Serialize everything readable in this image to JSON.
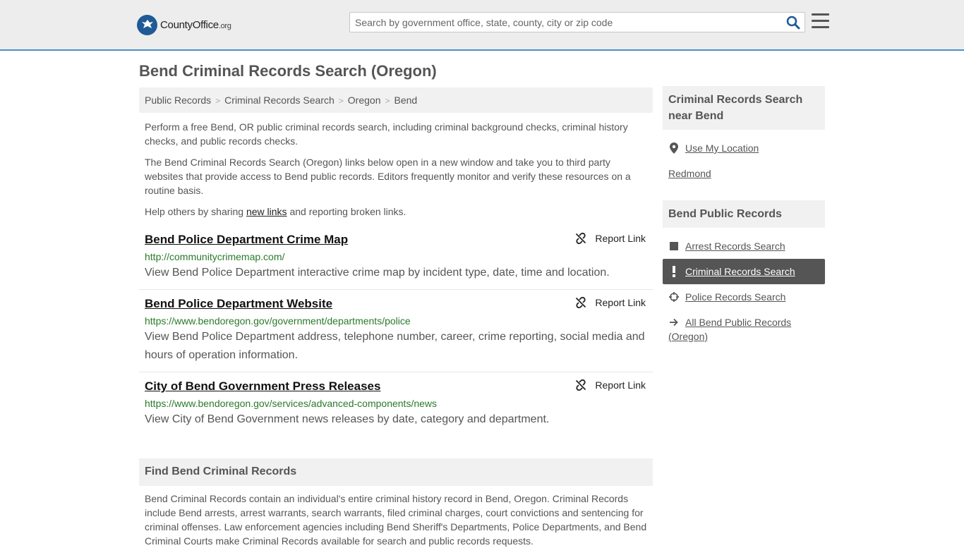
{
  "header": {
    "logo_main": "CountyOffice",
    "logo_tld": ".org",
    "search_placeholder": "Search by government office, state, county, city or zip code"
  },
  "page_title": "Bend Criminal Records Search (Oregon)",
  "breadcrumb": [
    "Public Records",
    "Criminal Records Search",
    "Oregon",
    "Bend"
  ],
  "intro": {
    "p1": "Perform a free Bend, OR public criminal records search, including criminal background checks, criminal history checks, and public records checks.",
    "p2": "The Bend Criminal Records Search (Oregon) links below open in a new window and take you to third party websites that provide access to Bend public records. Editors frequently monitor and verify these resources on a routine basis.",
    "p3_before": "Help others by sharing ",
    "p3_link": "new links",
    "p3_after": " and reporting broken links."
  },
  "report_label": "Report Link",
  "entries": [
    {
      "title": "Bend Police Department Crime Map",
      "url": "http://communitycrimemap.com/",
      "desc": "View Bend Police Department interactive crime map by incident type, date, time and location."
    },
    {
      "title": "Bend Police Department Website",
      "url": "https://www.bendoregon.gov/government/departments/police",
      "desc": "View Bend Police Department address, telephone number, career, crime reporting, social media and hours of operation information."
    },
    {
      "title": "City of Bend Government Press Releases",
      "url": "https://www.bendoregon.gov/services/advanced-components/news",
      "desc": "View City of Bend Government news releases by date, category and department."
    }
  ],
  "find": {
    "heading": "Find Bend Criminal Records",
    "text": "Bend Criminal Records contain an individual's entire criminal history record in Bend, Oregon. Criminal Records include Bend arrests, arrest warrants, search warrants, filed criminal charges, court convictions and sentencing for criminal offenses. Law enforcement agencies including Bend Sheriff's Departments, Police Departments, and Bend Criminal Courts make Criminal Records available for search and public records requests."
  },
  "sidebar": {
    "near_heading": "Criminal Records Search near Bend",
    "use_location": "Use My Location",
    "nearby": "Redmond",
    "public_heading": "Bend Public Records",
    "links": [
      {
        "label": "Arrest Records Search",
        "icon": "square-icon"
      },
      {
        "label": "Criminal Records Search",
        "icon": "exclamation-icon",
        "active": true
      },
      {
        "label": "Police Records Search",
        "icon": "crosshair-icon"
      },
      {
        "label": "All Bend Public Records (Oregon)",
        "icon": "arrow-right-icon"
      }
    ]
  },
  "colors": {
    "accent_border": "#4a90c8",
    "url_green": "#2a7a2a",
    "active_bg": "#555555"
  }
}
